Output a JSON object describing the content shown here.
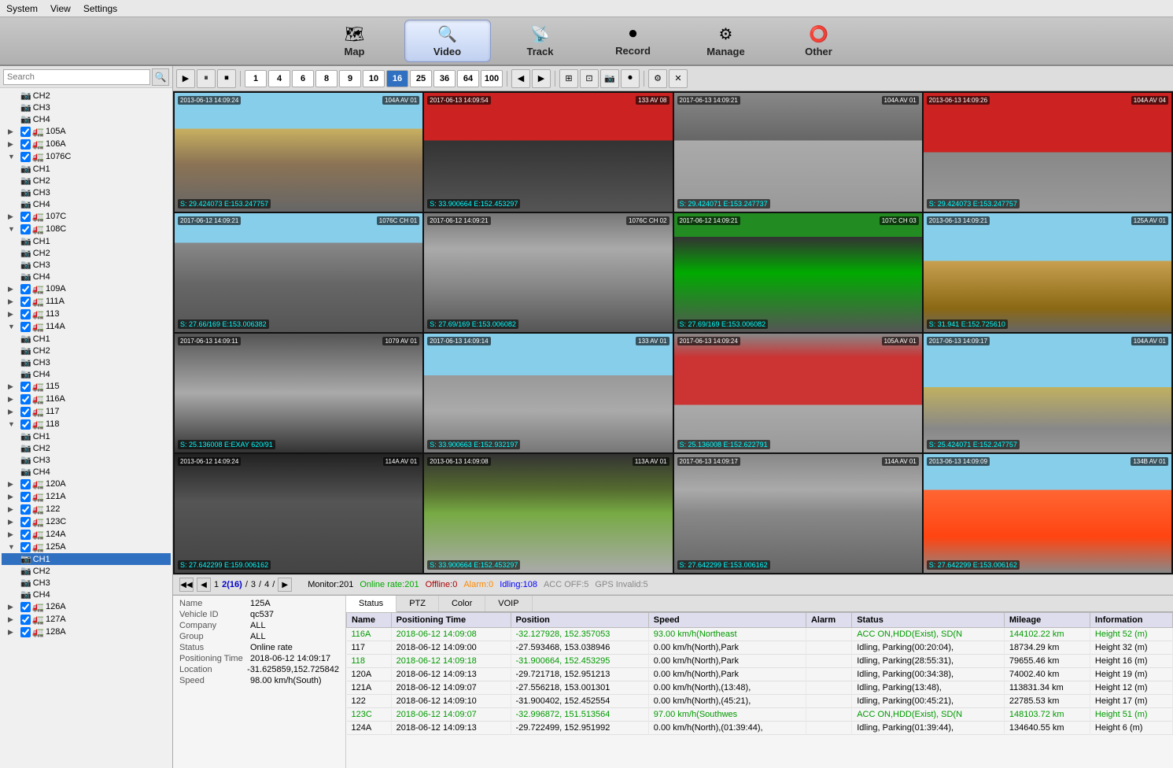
{
  "menubar": {
    "system": "System",
    "view": "View",
    "settings": "Settings"
  },
  "topnav": {
    "buttons": [
      {
        "id": "map",
        "label": "Map",
        "icon": "🗺",
        "active": false
      },
      {
        "id": "video",
        "label": "Video",
        "icon": "🔍",
        "active": true
      },
      {
        "id": "track",
        "label": "Track",
        "icon": "📡",
        "active": false
      },
      {
        "id": "record",
        "label": "Record",
        "icon": "⏺",
        "active": false
      },
      {
        "id": "manage",
        "label": "Manage",
        "icon": "⚙",
        "active": false
      },
      {
        "id": "other",
        "label": "Other",
        "icon": "⭕",
        "active": false
      }
    ]
  },
  "sidebar": {
    "search_placeholder": "Search",
    "tree": [
      {
        "level": 2,
        "label": "CH2",
        "type": "channel",
        "checked": false,
        "expanded": false
      },
      {
        "level": 2,
        "label": "CH3",
        "type": "channel",
        "checked": false,
        "expanded": false
      },
      {
        "level": 2,
        "label": "CH4",
        "type": "channel",
        "checked": false,
        "expanded": false
      },
      {
        "level": 1,
        "label": "105A",
        "type": "vehicle",
        "checked": true,
        "expanded": false
      },
      {
        "level": 1,
        "label": "106A",
        "type": "vehicle",
        "checked": true,
        "expanded": false
      },
      {
        "level": 1,
        "label": "1076C",
        "type": "vehicle",
        "checked": true,
        "expanded": true
      },
      {
        "level": 2,
        "label": "CH1",
        "type": "channel",
        "checked": false,
        "expanded": false
      },
      {
        "level": 2,
        "label": "CH2",
        "type": "channel",
        "checked": false,
        "expanded": false
      },
      {
        "level": 2,
        "label": "CH3",
        "type": "channel",
        "checked": false,
        "expanded": false
      },
      {
        "level": 2,
        "label": "CH4",
        "type": "channel",
        "checked": false,
        "expanded": false
      },
      {
        "level": 1,
        "label": "107C",
        "type": "vehicle",
        "checked": true,
        "expanded": false
      },
      {
        "level": 1,
        "label": "108C",
        "type": "vehicle",
        "checked": true,
        "expanded": true
      },
      {
        "level": 2,
        "label": "CH1",
        "type": "channel",
        "checked": false,
        "expanded": false
      },
      {
        "level": 2,
        "label": "CH2",
        "type": "channel",
        "checked": false,
        "expanded": false
      },
      {
        "level": 2,
        "label": "CH3",
        "type": "channel",
        "checked": false,
        "expanded": false
      },
      {
        "level": 2,
        "label": "CH4",
        "type": "channel",
        "checked": false,
        "expanded": false
      },
      {
        "level": 1,
        "label": "109A",
        "type": "vehicle",
        "checked": true,
        "expanded": false
      },
      {
        "level": 1,
        "label": "111A",
        "type": "vehicle",
        "checked": true,
        "expanded": false
      },
      {
        "level": 1,
        "label": "113",
        "type": "vehicle",
        "checked": true,
        "expanded": false
      },
      {
        "level": 1,
        "label": "114A",
        "type": "vehicle",
        "checked": true,
        "expanded": true
      },
      {
        "level": 2,
        "label": "CH1",
        "type": "channel",
        "checked": false,
        "expanded": false
      },
      {
        "level": 2,
        "label": "CH2",
        "type": "channel",
        "checked": false,
        "expanded": false
      },
      {
        "level": 2,
        "label": "CH3",
        "type": "channel",
        "checked": false,
        "expanded": false
      },
      {
        "level": 2,
        "label": "CH4",
        "type": "channel",
        "checked": false,
        "expanded": false
      },
      {
        "level": 1,
        "label": "115",
        "type": "vehicle",
        "checked": true,
        "expanded": false
      },
      {
        "level": 1,
        "label": "116A",
        "type": "vehicle",
        "checked": true,
        "expanded": false
      },
      {
        "level": 1,
        "label": "117",
        "type": "vehicle",
        "checked": true,
        "expanded": false
      },
      {
        "level": 1,
        "label": "118",
        "type": "vehicle",
        "checked": true,
        "expanded": true
      },
      {
        "level": 2,
        "label": "CH1",
        "type": "channel",
        "checked": false,
        "expanded": false
      },
      {
        "level": 2,
        "label": "CH2",
        "type": "channel",
        "checked": false,
        "expanded": false
      },
      {
        "level": 2,
        "label": "CH3",
        "type": "channel",
        "checked": false,
        "expanded": false
      },
      {
        "level": 2,
        "label": "CH4",
        "type": "channel",
        "checked": false,
        "expanded": false
      },
      {
        "level": 1,
        "label": "120A",
        "type": "vehicle",
        "checked": true,
        "expanded": false
      },
      {
        "level": 1,
        "label": "121A",
        "type": "vehicle",
        "checked": true,
        "expanded": false
      },
      {
        "level": 1,
        "label": "122",
        "type": "vehicle",
        "checked": true,
        "expanded": false
      },
      {
        "level": 1,
        "label": "123C",
        "type": "vehicle",
        "checked": true,
        "expanded": false
      },
      {
        "level": 1,
        "label": "124A",
        "type": "vehicle",
        "checked": true,
        "expanded": false
      },
      {
        "level": 1,
        "label": "125A",
        "type": "vehicle",
        "checked": true,
        "expanded": true
      },
      {
        "level": 2,
        "label": "CH1",
        "type": "channel",
        "checked": false,
        "expanded": false,
        "selected": true
      },
      {
        "level": 2,
        "label": "CH2",
        "type": "channel",
        "checked": false,
        "expanded": false
      },
      {
        "level": 2,
        "label": "CH3",
        "type": "channel",
        "checked": false,
        "expanded": false
      },
      {
        "level": 2,
        "label": "CH4",
        "type": "channel",
        "checked": false,
        "expanded": false
      },
      {
        "level": 1,
        "label": "126A",
        "type": "vehicle",
        "checked": true,
        "expanded": false
      },
      {
        "level": 1,
        "label": "127A",
        "type": "vehicle",
        "checked": true,
        "expanded": false
      },
      {
        "level": 1,
        "label": "128A",
        "type": "vehicle",
        "checked": true,
        "expanded": false
      }
    ]
  },
  "toolbar": {
    "layout_btns": [
      "1",
      "4",
      "6",
      "8",
      "9",
      "10",
      "16",
      "25",
      "36",
      "64",
      "100"
    ],
    "active_layout": "16"
  },
  "pagination": {
    "prev_prev": "◀◀",
    "prev": "◀",
    "page_input": "1",
    "current": "2",
    "total_pages": "16",
    "slash1": "/",
    "page3": "3",
    "slash2": "/",
    "page4": "4",
    "slash3": "/",
    "next": "▶"
  },
  "status_bar": {
    "monitor_label": "Monitor:201",
    "online_label": "Online rate:201",
    "offline_label": "Offline:0",
    "alarm_label": "Alarm:0",
    "idling_label": "Idling:108",
    "acc_label": "ACC OFF:5",
    "gps_label": "GPS Invalid:5"
  },
  "info_panel": {
    "name_label": "Name",
    "name_value": "125A",
    "vehicle_id_label": "Vehicle ID",
    "vehicle_id_value": "qc537",
    "company_label": "Company",
    "company_value": "ALL",
    "group_label": "Group",
    "group_value": "ALL",
    "status_label": "Status",
    "status_value": "Online rate",
    "pos_time_label": "Positioning Time",
    "pos_time_value": "2018-06-12 14:09:17",
    "location_label": "Location",
    "location_value": "-31.625859,152.725842",
    "speed_label": "Speed",
    "speed_value": "98.00 km/h(South)"
  },
  "bottom_tabs": [
    "Status",
    "PTZ",
    "Color",
    "VOIP"
  ],
  "table": {
    "columns": [
      "Name",
      "Positioning Time",
      "Position",
      "Speed",
      "Alarm",
      "Status",
      "Mileage",
      "Information"
    ],
    "rows": [
      {
        "name": "116A",
        "name_color": "green",
        "pos_time": "2018-06-12 14:09:08",
        "pos_time_color": "green",
        "position": "-32.127928, 152.357053",
        "position_color": "green",
        "speed": "93.00 km/h(Northeast",
        "speed_color": "green",
        "alarm": "",
        "status": "ACC ON,HDD(Exist), SD(N",
        "status_color": "green",
        "mileage": "144102.22 km",
        "mileage_color": "green",
        "info": "Height 52 (m)",
        "info_color": "green"
      },
      {
        "name": "117",
        "name_color": "black",
        "pos_time": "2018-06-12 14:09:00",
        "pos_time_color": "black",
        "position": "-27.593468, 153.038946",
        "position_color": "black",
        "speed": "0.00 km/h(North),Park",
        "speed_color": "black",
        "alarm": "",
        "status": "Idling, Parking(00:20:04),",
        "status_color": "black",
        "mileage": "18734.29 km",
        "mileage_color": "black",
        "info": "Height 32 (m)",
        "info_color": "black"
      },
      {
        "name": "118",
        "name_color": "green",
        "pos_time": "2018-06-12 14:09:18",
        "pos_time_color": "green",
        "position": "-31.900664, 152.453295",
        "position_color": "green",
        "speed": "0.00 km/h(North),Park",
        "speed_color": "black",
        "alarm": "",
        "status": "Idling, Parking(28:55:31),",
        "status_color": "black",
        "mileage": "79655.46 km",
        "mileage_color": "black",
        "info": "Height 16 (m)",
        "info_color": "black"
      },
      {
        "name": "120A",
        "name_color": "black",
        "pos_time": "2018-06-12 14:09:13",
        "pos_time_color": "black",
        "position": "-29.721718, 152.951213",
        "position_color": "black",
        "speed": "0.00 km/h(North),Park",
        "speed_color": "black",
        "alarm": "",
        "status": "Idling, Parking(00:34:38),",
        "status_color": "black",
        "mileage": "74002.40 km",
        "mileage_color": "black",
        "info": "Height 19 (m)",
        "info_color": "black"
      },
      {
        "name": "121A",
        "name_color": "black",
        "pos_time": "2018-06-12 14:09:07",
        "pos_time_color": "black",
        "position": "-27.556218, 153.001301",
        "position_color": "black",
        "speed": "0.00 km/h(North),(13:48),",
        "speed_color": "black",
        "alarm": "",
        "status": "Idling, Parking(13:48),",
        "status_color": "black",
        "mileage": "113831.34 km",
        "mileage_color": "black",
        "info": "Height 12 (m)",
        "info_color": "black"
      },
      {
        "name": "122",
        "name_color": "black",
        "pos_time": "2018-06-12 14:09:10",
        "pos_time_color": "black",
        "position": "-31.900402, 152.452554",
        "position_color": "black",
        "speed": "0.00 km/h(North),(45:21),",
        "speed_color": "black",
        "alarm": "",
        "status": "Idling, Parking(00:45:21),",
        "status_color": "black",
        "mileage": "22785.53 km",
        "mileage_color": "black",
        "info": "Height 17 (m)",
        "info_color": "black"
      },
      {
        "name": "123C",
        "name_color": "green",
        "pos_time": "2018-06-12 14:09:07",
        "pos_time_color": "green",
        "position": "-32.996872, 151.513564",
        "position_color": "green",
        "speed": "97.00 km/h(Southwes",
        "speed_color": "green",
        "alarm": "",
        "status": "ACC ON,HDD(Exist), SD(N",
        "status_color": "green",
        "mileage": "148103.72 km",
        "mileage_color": "green",
        "info": "Height 51 (m)",
        "info_color": "green"
      },
      {
        "name": "124A",
        "name_color": "black",
        "pos_time": "2018-06-12 14:09:13",
        "pos_time_color": "black",
        "position": "-29.722499, 152.951992",
        "position_color": "black",
        "speed": "0.00 km/h(North),(01:39:44),",
        "speed_color": "black",
        "alarm": "",
        "status": "Idling, Parking(01:39:44),",
        "status_color": "black",
        "mileage": "134640.55 km",
        "mileage_color": "black",
        "info": "Height 6 (m)",
        "info_color": "black"
      }
    ]
  },
  "cameras": [
    {
      "id": "c1",
      "tag_left": "2013-06-13 14:09:24",
      "tag_right": "104A AV 01",
      "coords": "S: 29.424073 E:153.247757",
      "class": "cam1"
    },
    {
      "id": "c2",
      "tag_left": "2017-06-13 14:09:54",
      "tag_right": "133 AV 08",
      "coords": "S: 33.900664 E:152.453297",
      "class": "cam2"
    },
    {
      "id": "c3",
      "tag_left": "2017-06-13 14:09:21",
      "tag_right": "104A AV 01",
      "coords": "S: 29.424071 E:153.247737",
      "class": "cam3"
    },
    {
      "id": "c4",
      "tag_left": "2013-06-13 14:09:26",
      "tag_right": "104A AV 04",
      "coords": "S: 29.424073 E:153.247757",
      "class": "cam4"
    },
    {
      "id": "c5",
      "tag_left": "2017-06-12 14:09:21",
      "tag_right": "1076C CH 01",
      "coords": "S: 27.66/169 E:153.006382",
      "class": "cam5"
    },
    {
      "id": "c6",
      "tag_left": "2017-06-12 14:09:21",
      "tag_right": "1076C CH 02",
      "coords": "S: 27.69/169 E:153.006082",
      "class": "cam6"
    },
    {
      "id": "c7",
      "tag_left": "2017-06-12 14:09:21",
      "tag_right": "107C CH 03",
      "coords": "S: 27.69/169 E:153.006082",
      "class": "cam7"
    },
    {
      "id": "c8",
      "tag_left": "2013-06-13 14:09:21",
      "tag_right": "125A AV 01",
      "coords": "S: 31.941 E:152.725610",
      "class": "cam8"
    },
    {
      "id": "c9",
      "tag_left": "2017-06-13 14:09:11",
      "tag_right": "1079 AV 01",
      "coords": "S: 25.136008 E:EXAY 620/91",
      "class": "cam9"
    },
    {
      "id": "c10",
      "tag_left": "2017-06-13 14:09:14",
      "tag_right": "133 AV 01",
      "coords": "S: 33.900663 E:152.932197",
      "class": "cam10"
    },
    {
      "id": "c11",
      "tag_left": "2017-06-13 14:09:24",
      "tag_right": "105A AV 01",
      "coords": "S: 25.136008 E:152.622791",
      "class": "cam11"
    },
    {
      "id": "c12",
      "tag_left": "2017-06-13 14:09:17",
      "tag_right": "104A AV 01",
      "coords": "S: 25.424071 E:152.247757",
      "class": "cam12"
    },
    {
      "id": "c13",
      "tag_left": "2013-06-12 14:09:24",
      "tag_right": "114A AV 01",
      "coords": "S: 27.642299 E:159.006162",
      "class": "cam13"
    },
    {
      "id": "c14",
      "tag_left": "2013-06-13 14:09:08",
      "tag_right": "113A AV 01",
      "coords": "S: 33.900664 E:152.453297",
      "class": "cam14"
    },
    {
      "id": "c15",
      "tag_left": "2017-06-13 14:09:17",
      "tag_right": "114A AV 01",
      "coords": "S: 27.642299 E:153.006162",
      "class": "cam15"
    },
    {
      "id": "c16",
      "tag_left": "2013-06-13 14:09:09",
      "tag_right": "134B AV 01",
      "coords": "S: 27.642299 E:153.006162",
      "class": "cam16"
    }
  ]
}
